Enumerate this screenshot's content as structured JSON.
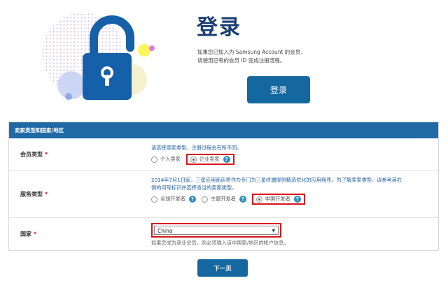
{
  "hero": {
    "title": "登录",
    "description_line1": "如果您已加入为 Samsung Account 的会员，",
    "description_line2": "请使用已有的会员 ID 完成注册流程。",
    "login_button": "登录"
  },
  "form": {
    "section_title": "卖家类型和国家/地区",
    "required_mark": "*",
    "member_type": {
      "label": "会员类型",
      "hint": "请选择卖家类型。注册过程会有所不同。",
      "options": [
        {
          "label": "个人卖家",
          "selected": false
        },
        {
          "label": "企业卖家",
          "selected": true
        }
      ]
    },
    "service_type": {
      "label": "服务类型",
      "hint_line1": "2014年7月1日起，三星应用商店将作为专门为三星终端提供精选优化的应用程序。为了解卖家类型，请参考其右",
      "hint_line2": "侧的问号标识并选择适当的卖家类型。",
      "options": [
        {
          "label": "全球开发者",
          "selected": false
        },
        {
          "label": "主题开发者",
          "selected": false
        },
        {
          "label": "中国开发者",
          "selected": true
        }
      ]
    },
    "country": {
      "label": "国家",
      "selected_value": "China",
      "hint": "如果您成为商业会员，则必须输入该中国家/地区的帐户信息。"
    }
  },
  "next_button": "下一页",
  "icons": {
    "help": "?",
    "dropdown": "▼"
  },
  "colors": {
    "brand_blue": "#15689f",
    "header_blue": "#1f6aa5",
    "highlight_red": "#d9141b"
  }
}
